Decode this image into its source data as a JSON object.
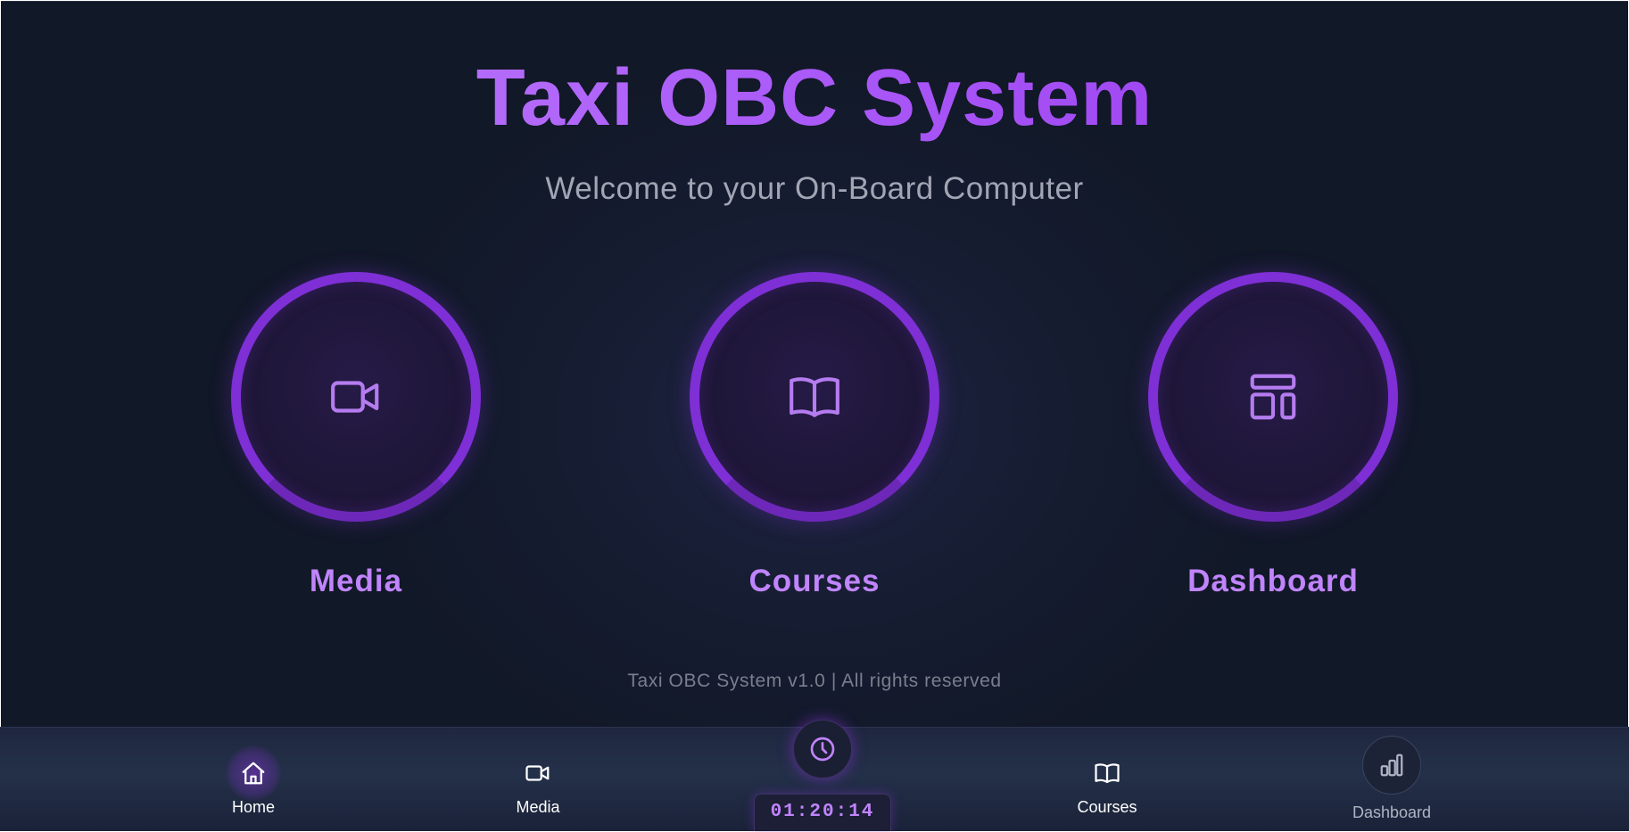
{
  "header": {
    "title": "Taxi OBC System",
    "subtitle": "Welcome to your On-Board Computer"
  },
  "features": [
    {
      "label": "Media",
      "icon": "video-camera-icon"
    },
    {
      "label": "Courses",
      "icon": "open-book-icon"
    },
    {
      "label": "Dashboard",
      "icon": "layout-panels-icon"
    }
  ],
  "footer": {
    "text": "Taxi OBC System v1.0 | All rights reserved"
  },
  "bottom_nav": {
    "items": [
      {
        "label": "Home",
        "icon": "home-icon",
        "active": true
      },
      {
        "label": "Media",
        "icon": "video-camera-icon",
        "active": false
      },
      {
        "label": "Courses",
        "icon": "open-book-icon",
        "active": false
      },
      {
        "label": "Dashboard",
        "icon": "bar-chart-icon",
        "active": false
      }
    ],
    "clock_icon": "clock-icon",
    "timer": "01:20:14"
  },
  "colors": {
    "accent": "#a855f7",
    "accent_light": "#c084fc",
    "ring": "#7e2fd6",
    "background": "#111827",
    "nav_background": "#243049",
    "muted_text": "#a1a5b4"
  }
}
